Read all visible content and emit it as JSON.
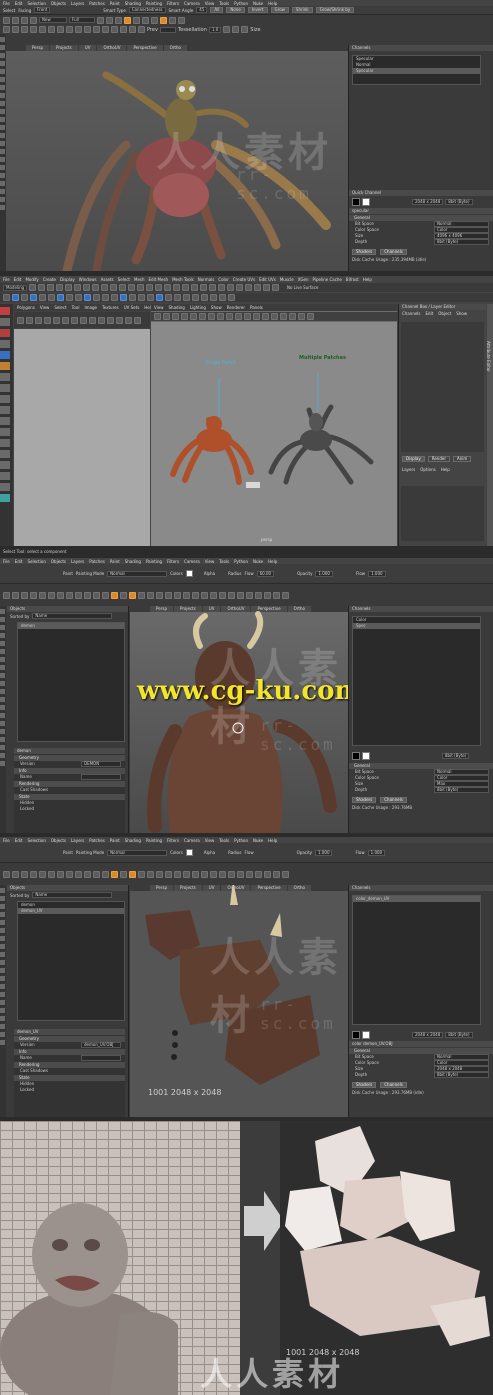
{
  "screen1": {
    "menus": [
      "File",
      "Edit",
      "Selection",
      "Objects",
      "Layers",
      "Patches",
      "Paint",
      "Shading",
      "Painting",
      "Filters",
      "Camera",
      "View",
      "Tools",
      "Python",
      "Nuke",
      "Help"
    ],
    "tool_options": {
      "select_label": "Select",
      "facing_label": "Facing",
      "facing_value": "Front",
      "smart_type_label": "Smart Type",
      "smart_type_value": "Connectedness",
      "smart_angle_label": "Smart Angle",
      "smart_angle_value": "45",
      "buttons": [
        "All",
        "None",
        "Invert",
        "Grow",
        "Shrink",
        "Grow/Shrink by"
      ]
    },
    "shelf": {
      "new_label": "New",
      "fill_label": "Full",
      "prev_label": "Prev",
      "tessellation_label": "Tessellation",
      "tessellation_value": "1.0",
      "size_label": "Size"
    },
    "view_tabs": [
      "Persp",
      "Projects",
      "UV",
      "OrthoUV",
      "Perspective",
      "Ortho"
    ],
    "channels": {
      "title": "Channels",
      "items": [
        "Specular",
        "Normal",
        "Specular"
      ],
      "quick_channel": "Quick Channel",
      "layer_name": "specular",
      "section": "General",
      "props": [
        [
          "Bit Space",
          "Normal"
        ],
        [
          "Color Space",
          "Color"
        ],
        [
          "Size",
          "4096 x 4096"
        ],
        [
          "Depth",
          "8bit (Byte)"
        ]
      ],
      "size_value": "2048 x 2048",
      "depth_value": "8bit (Byte)",
      "tabs": [
        "Shaders",
        "Channels"
      ],
      "cache": "Disk Cache Usage : 235.394MB (idle)"
    }
  },
  "screen2": {
    "menus": [
      "File",
      "Edit",
      "Modify",
      "Create",
      "Display",
      "Windows",
      "Assets",
      "Select",
      "Mesh",
      "Edit Mesh",
      "Mesh Tools",
      "Normals",
      "Color",
      "Create UVs",
      "Edit UVs",
      "Muscle",
      "XGen",
      "Pipeline Cache",
      "Bifrost",
      "Help"
    ],
    "mode": "Modeling",
    "uv_panel_tabs": [
      "Polygons",
      "View",
      "Select",
      "Tool",
      "Image",
      "Textures",
      "UV Sets",
      "Help"
    ],
    "persp_menus": [
      "View",
      "Shading",
      "Lighting",
      "Show",
      "Renderer",
      "Panels"
    ],
    "live_surface": "No Live Surface",
    "labels": {
      "single_patch": "Single Patch",
      "multiple_patches": "Multiple Patches"
    },
    "persp_label": "persp",
    "channel_box": {
      "title": "Channel Box / Layer Editor",
      "menus": [
        "Channels",
        "Edit",
        "Object",
        "Show"
      ],
      "layer_tabs": [
        "Display",
        "Render",
        "Anim"
      ],
      "layer_menus": [
        "Layers",
        "Options",
        "Help"
      ]
    },
    "side_tab": "Attribute Editor",
    "status": "Select Tool: select a component"
  },
  "screen3": {
    "menus": [
      "File",
      "Edit",
      "Selection",
      "Objects",
      "Layers",
      "Patches",
      "Paint",
      "Shading",
      "Painting",
      "Filters",
      "Camera",
      "View",
      "Tools",
      "Python",
      "Nuke",
      "Help"
    ],
    "tool_options": {
      "paint_label": "Paint",
      "painting_mode_label": "Painting Mode",
      "painting_mode_value": "Normal",
      "colors_label": "Colors",
      "alpha_label": "Alpha",
      "radius_label": "Radius",
      "radius_value": "60.00",
      "flow_label": "Flow",
      "opacity_label": "Opacity",
      "opacity_value": "1.000",
      "flow2_label": "Flow",
      "flow2_value": "1.000"
    },
    "outliner": {
      "title": "Objects",
      "sorted_by": "Sorted by",
      "sort_value": "Name",
      "items": [
        "demon"
      ]
    },
    "view_tabs": [
      "Persp",
      "Projects",
      "UV",
      "OrthoUV",
      "Perspective",
      "Ortho"
    ],
    "props_panel": {
      "object": "demon",
      "sections": [
        "Geometry",
        "Info",
        "Rendering",
        "State"
      ],
      "fields": [
        [
          "Version",
          "DEMON"
        ],
        [
          "Name",
          ""
        ],
        [
          "Cast Shadows",
          ""
        ],
        [
          "Hidden",
          ""
        ],
        [
          "Locked",
          ""
        ]
      ]
    },
    "channels": {
      "title": "Channels",
      "items": [
        "Color",
        "Spec"
      ],
      "section": "General",
      "props": [
        [
          "Bit Space",
          "Normal"
        ],
        [
          "Color Space",
          "Color"
        ],
        [
          "Size",
          "Max"
        ],
        [
          "Depth",
          "8bit (Byte)"
        ]
      ],
      "depth_value": "8bit (Byte)",
      "tabs": [
        "Shaders",
        "Channels"
      ],
      "cache": "Disk Cache Usage : 293.76MB"
    }
  },
  "screen4": {
    "menus": [
      "File",
      "Edit",
      "Selection",
      "Objects",
      "Layers",
      "Patches",
      "Paint",
      "Shading",
      "Painting",
      "Filters",
      "Camera",
      "View",
      "Tools",
      "Python",
      "Nuke",
      "Help"
    ],
    "outliner": {
      "title": "Objects",
      "sorted_by": "Sorted by",
      "sort_value": "Name",
      "items": [
        "demon",
        "demon_UV"
      ]
    },
    "view_tabs": [
      "Persp",
      "Projects",
      "UV",
      "OrthoUV",
      "Perspective",
      "Ortho"
    ],
    "uv_label": "1001 2048 x 2048",
    "props_panel": {
      "object": "demon_UV",
      "sections": [
        "Geometry",
        "Info",
        "Rendering",
        "State"
      ],
      "fields": [
        [
          "Version",
          "demon_UV.OBJ"
        ],
        [
          "Name",
          ""
        ],
        [
          "Cast Shadows",
          ""
        ],
        [
          "Hidden",
          ""
        ],
        [
          "Locked",
          ""
        ]
      ]
    },
    "channels": {
      "title": "Channels",
      "items": [
        "color_demon_UV"
      ],
      "layer_name": "color demon_UV.OBJ",
      "section": "General",
      "props": [
        [
          "Bit Space",
          "Normal"
        ],
        [
          "Color Space",
          "Color"
        ],
        [
          "Size",
          "2048 x 2048"
        ],
        [
          "Depth",
          "8bit (Byte)"
        ]
      ],
      "size_value": "2048 x 2048",
      "depth_value": "8bit (Byte)",
      "tabs": [
        "Shaders",
        "Channels"
      ],
      "cache": "Disk Cache Usage : 293.76MB (idle)"
    }
  },
  "screen5": {
    "uv_label": "1001 2048 x 2048"
  },
  "watermarks": {
    "cn": "人人素材",
    "sub": "rr-sc.com",
    "cgku": "www.cg-ku.com"
  }
}
